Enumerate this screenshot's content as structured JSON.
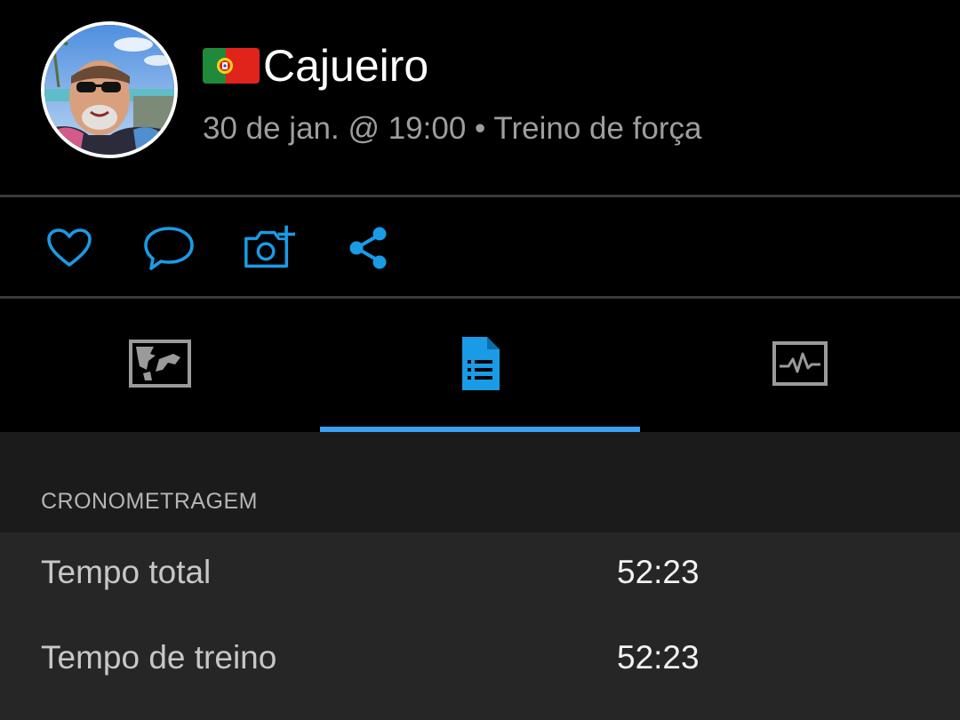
{
  "profile": {
    "name": "Cajueiro",
    "flag_icon": "portugal-flag-icon",
    "activity_meta": "30 de jan. @ 19:00 • Treino de força"
  },
  "actions": {
    "icons": [
      "heart-icon",
      "comment-icon",
      "add-photo-icon",
      "share-icon"
    ],
    "accent_color": "#1a9be6"
  },
  "tabs": {
    "items": [
      "map-icon",
      "details-icon",
      "chart-icon"
    ],
    "selected_index": 1,
    "indicator_color": "#3aa0f0"
  },
  "timing": {
    "section_title": "CRONOMETRAGEM",
    "rows": [
      {
        "label": "Tempo total",
        "value": "52:23"
      },
      {
        "label": "Tempo de treino",
        "value": "52:23"
      }
    ]
  }
}
